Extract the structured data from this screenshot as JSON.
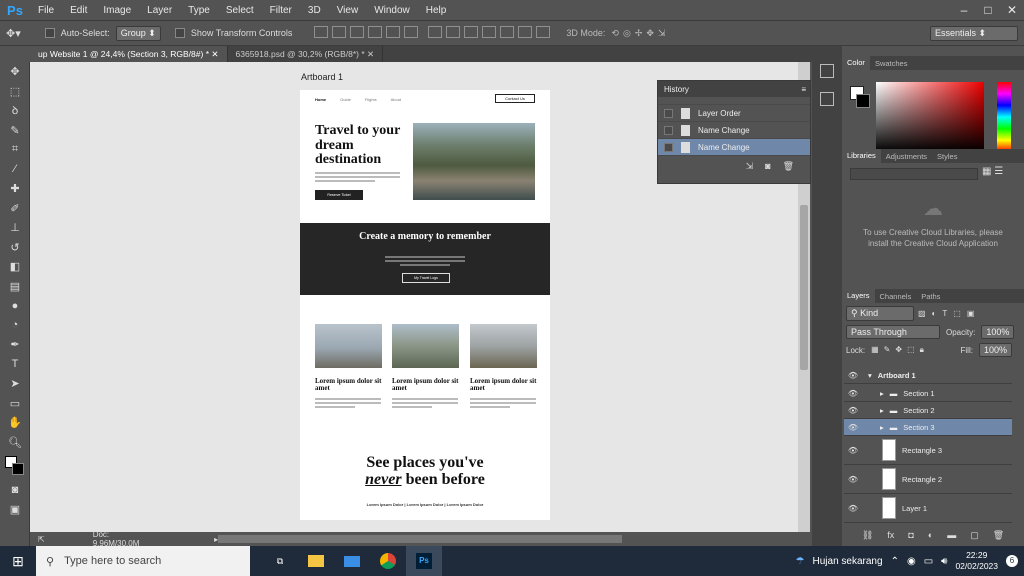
{
  "app": {
    "logo": "Ps"
  },
  "menu": [
    "File",
    "Edit",
    "Image",
    "Layer",
    "Type",
    "Select",
    "Filter",
    "3D",
    "View",
    "Window",
    "Help"
  ],
  "window_controls": [
    "–",
    "□",
    "✕"
  ],
  "options": {
    "auto_select_label": "Auto-Select:",
    "auto_select_value": "Group",
    "transform_label": "Show Transform Controls",
    "mode3d_label": "3D Mode:",
    "workspace": "Essentials"
  },
  "tabs": [
    {
      "label": "up Website 1 @ 24,4% (Section 3, RGB/8#) *"
    },
    {
      "label": "6365918.psd @ 30,2% (RGB/8*) *"
    }
  ],
  "tab_close": "✕",
  "status": {
    "zoom_prefix": "",
    "doc": "Doc: 9,96M/30,0M"
  },
  "artboard": {
    "label": "Artboard 1",
    "nav": [
      "Home",
      "Guide",
      "Flights",
      "About"
    ],
    "contact": "Contact Us",
    "hero_title": "Travel to your dream destination",
    "hero_button": "Reserve Ticket",
    "dark_title": "Create a memory to remember",
    "dark_button": "My Travel Logs",
    "cards": [
      {
        "title": "Lorem ipsum dolor sit amet"
      },
      {
        "title": "Lorem ipsum dolor sit amet"
      },
      {
        "title": "Lorem ipsum dolor sit amet"
      }
    ],
    "bottom_title_1": "See places you've",
    "bottom_title_em": "never",
    "bottom_title_2": "been before",
    "bottom_links": "Lorem Ipsum Dolor | Lorem Ipsum Dolor | Lorem Ipsum Dolor"
  },
  "history": {
    "title": "History",
    "rows": [
      {
        "label": "Layer Order",
        "selected": false
      },
      {
        "label": "Name Change",
        "selected": false
      },
      {
        "label": "Name Change",
        "selected": true
      }
    ]
  },
  "color_panel": {
    "tabs": [
      "Color",
      "Swatches"
    ],
    "fg": "#ffffff",
    "bg": "#000000"
  },
  "libraries_panel": {
    "tabs": [
      "Libraries",
      "Adjustments",
      "Styles"
    ],
    "message": "To use Creative Cloud Libraries, please install the Creative Cloud Application"
  },
  "layers_panel": {
    "tabs": [
      "Layers",
      "Channels",
      "Paths"
    ],
    "kind": "Kind",
    "blend": "Pass Through",
    "opacity_label": "Opacity:",
    "opacity": "100%",
    "lock_label": "Lock:",
    "fill_label": "Fill:",
    "fill": "100%",
    "layers": [
      {
        "name": "Artboard 1",
        "type": "artboard"
      },
      {
        "name": "Section 1",
        "type": "group"
      },
      {
        "name": "Section 2",
        "type": "group"
      },
      {
        "name": "Section 3",
        "type": "group",
        "selected": true
      },
      {
        "name": "Rectangle 3",
        "type": "shape"
      },
      {
        "name": "Rectangle 2",
        "type": "shape"
      },
      {
        "name": "Layer 1",
        "type": "pixel"
      }
    ]
  },
  "taskbar": {
    "search_placeholder": "Type here to search",
    "weather": "Hujan sekarang",
    "time": "22:29",
    "date": "02/02/2023",
    "notifications": "6"
  }
}
